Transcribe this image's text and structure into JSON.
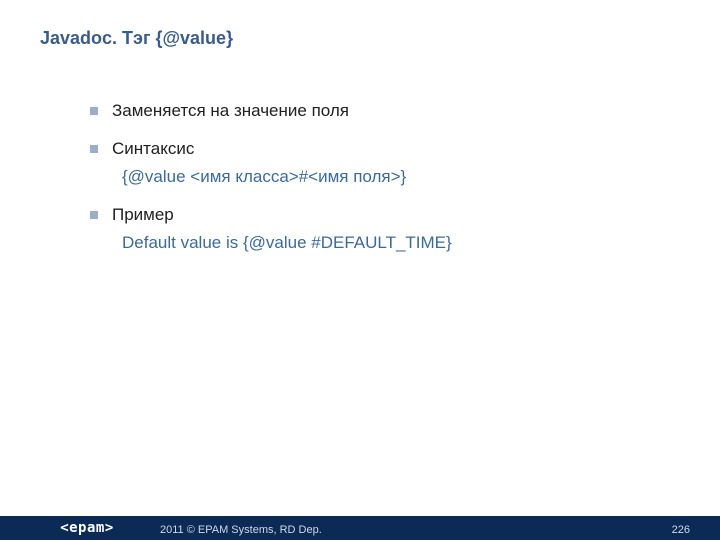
{
  "title": "Javadoc. Тэг {@value}",
  "bullets": [
    {
      "text": "Заменяется на значение поля"
    },
    {
      "text": "Синтаксис",
      "sub": "{@value <имя класса>#<имя поля>}"
    },
    {
      "text": "Пример",
      "sub": "Default value is {@value #DEFAULT_TIME}"
    }
  ],
  "footer": {
    "logo": "<epam>",
    "copyright_year": "2011",
    "copyright_sym": "©",
    "copyright_rest": "EPAM Systems, RD Dep.",
    "page": "226"
  }
}
